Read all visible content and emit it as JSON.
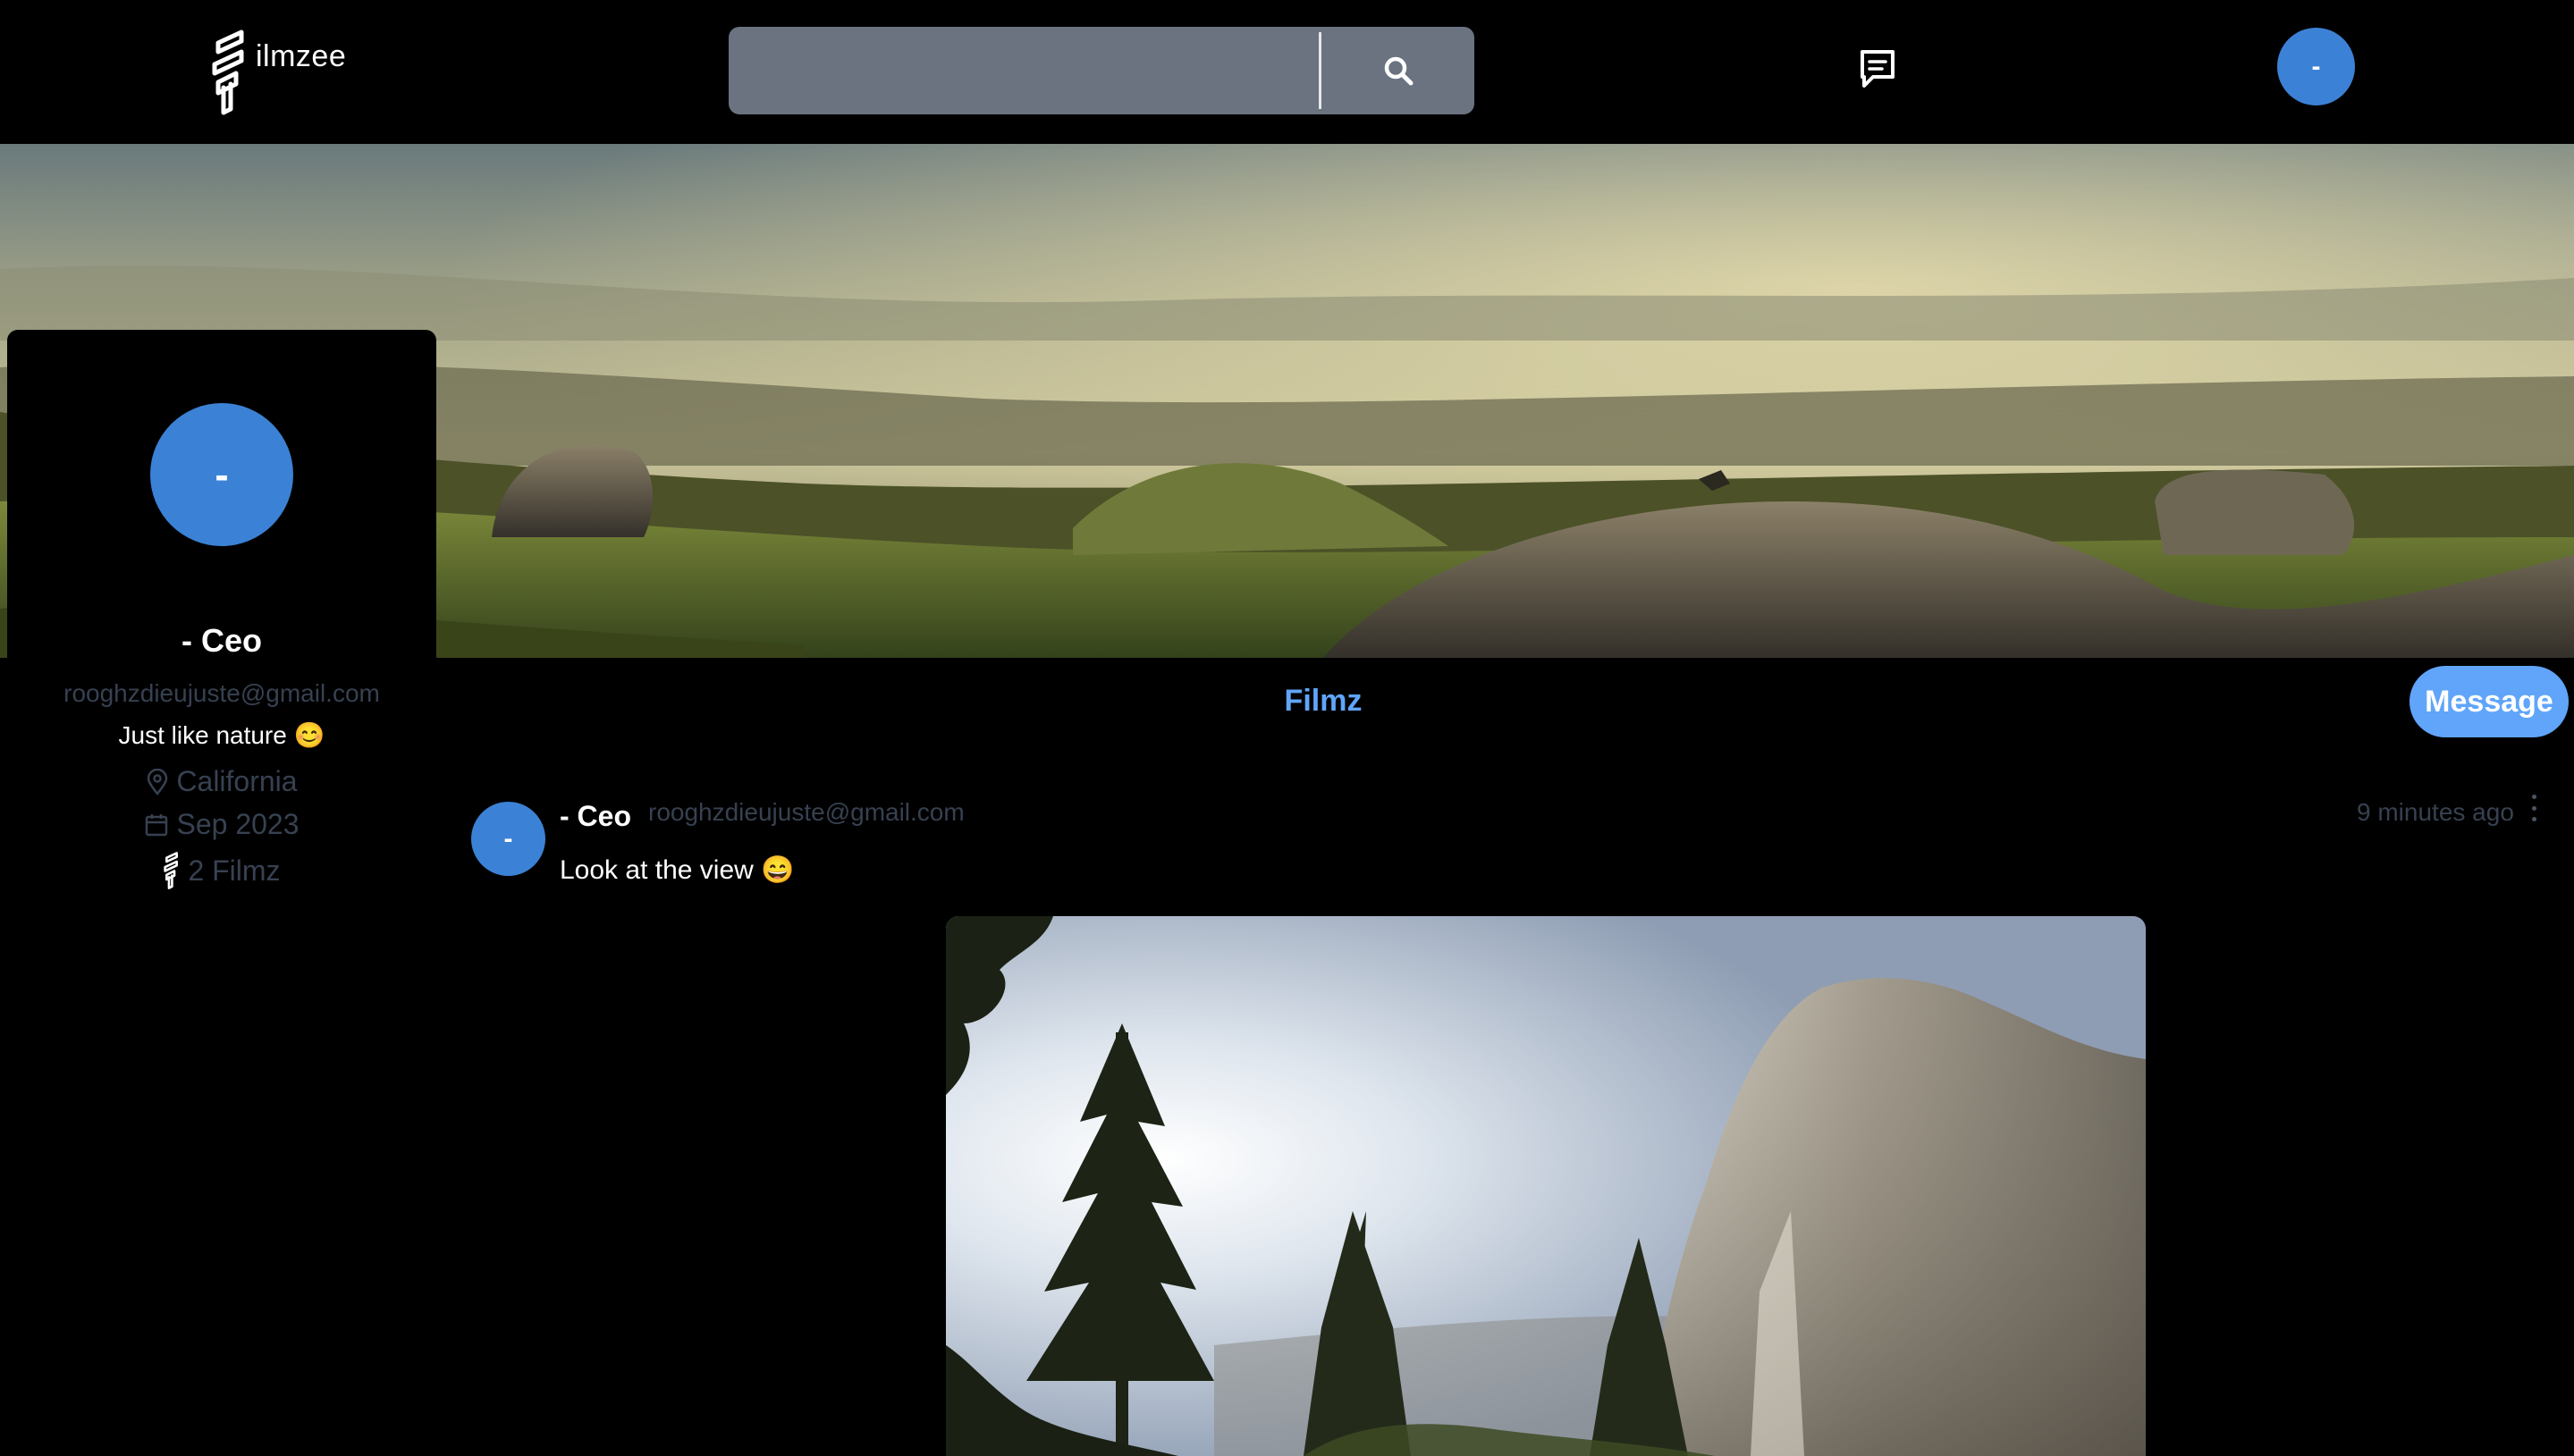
{
  "header": {
    "logo_text": "ilmzee",
    "search_placeholder": "",
    "avatar_initial": "-"
  },
  "profile": {
    "avatar_initial": "-",
    "name": "- Ceo",
    "email": "rooghzdieujuste@gmail.com",
    "bio": "Just like nature 😊",
    "location": "California",
    "joined": "Sep 2023",
    "filmz_count": "2 Filmz"
  },
  "tabs": {
    "filmz": "Filmz",
    "message_button": "Message"
  },
  "post": {
    "avatar_initial": "-",
    "author": "- Ceo",
    "email": "rooghzdieujuste@gmail.com",
    "time": "9 minutes ago",
    "text": "Look at the view 😄"
  },
  "colors": {
    "background": "#000000",
    "accent_blue": "#3b82d6",
    "link_blue": "#60a5fa",
    "search_bg": "#6b7280",
    "muted_text": "#374151"
  },
  "icons": {
    "search": "search-icon",
    "message": "message-icon",
    "location": "map-pin-icon",
    "calendar": "calendar-icon",
    "filmz": "filmz-logo-icon",
    "post_menu": "vertical-dots-icon"
  }
}
